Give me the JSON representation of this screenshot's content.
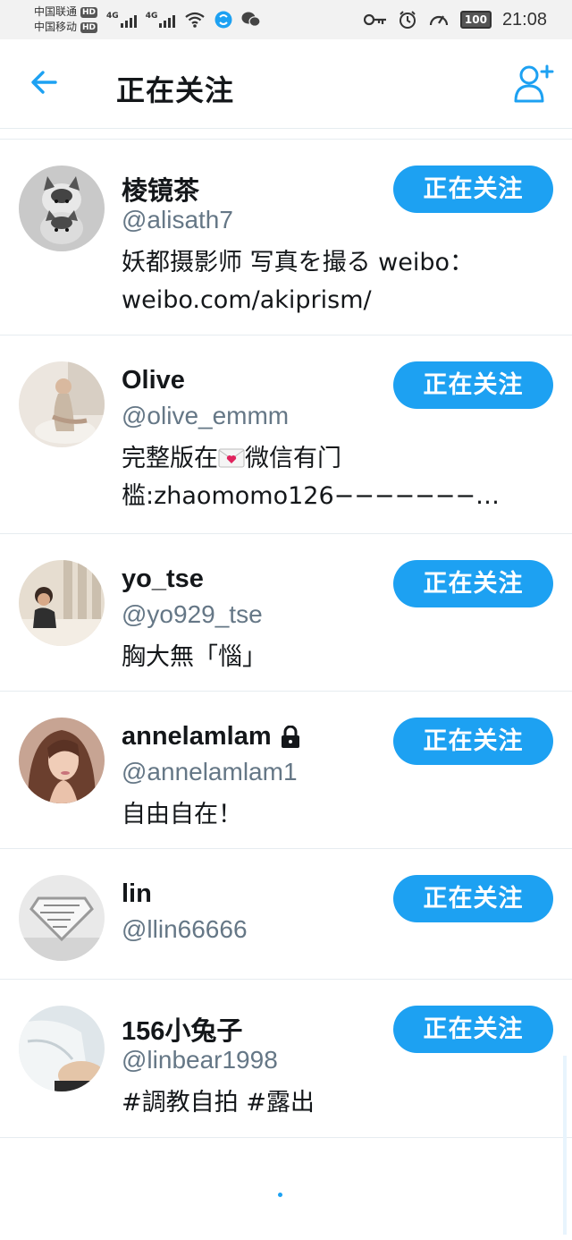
{
  "status_bar": {
    "carrier1": "中国联通",
    "carrier2": "中国移动",
    "hd": "HD",
    "network1": "4G",
    "network2": "4G",
    "battery": "100",
    "time": "21:08"
  },
  "header": {
    "title": "正在关注"
  },
  "colors": {
    "accent": "#1da1f2",
    "handle": "#657786",
    "text": "#14171a",
    "divider": "#e6ecf0"
  },
  "users": [
    {
      "name": "棱镜茶",
      "handle": "@alisath7",
      "bio_lines": [
        "妖都摄影师 写真を撮る weibo：",
        "weibo.com/akiprism/"
      ],
      "follow_label": "正在关注",
      "locked": false
    },
    {
      "name": "Olive",
      "handle": "@olive_emmm",
      "bio_lines": [
        "完整版在",
        "微信有门",
        "槛:zhaomomo126−−−−−−−…"
      ],
      "follow_label": "正在关注",
      "locked": false
    },
    {
      "name": "yo_tse",
      "handle": "@yo929_tse",
      "bio_lines": [
        "胸大無「惱」"
      ],
      "follow_label": "正在关注",
      "locked": false
    },
    {
      "name": "annelamlam",
      "handle": "@annelamlam1",
      "bio_lines": [
        "自由自在！"
      ],
      "follow_label": "正在关注",
      "locked": true
    },
    {
      "name": "lin",
      "handle": "@llin66666",
      "bio_lines": [],
      "follow_label": "正在关注",
      "locked": false
    },
    {
      "name": "156小兔子",
      "handle": "@linbear1998",
      "bio_lines": [
        "#調教自拍 #露出"
      ],
      "follow_label": "正在关注",
      "locked": false
    }
  ]
}
